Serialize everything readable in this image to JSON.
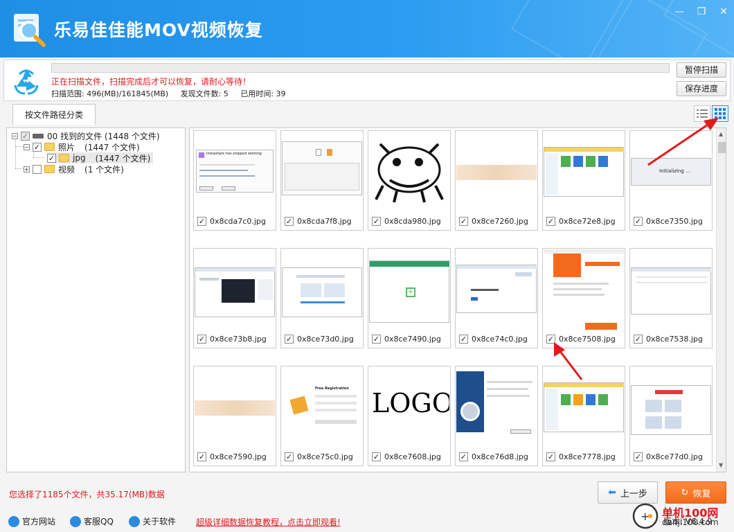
{
  "window": {
    "title": "乐易佳佳能MOV视频恢复",
    "minimize": "—",
    "maximize": "❐",
    "close": "✕"
  },
  "scan": {
    "progress": 0.0,
    "message": "正在扫描文件，扫描完成后才可以恢复，请耐心等待！",
    "range_label": "扫描范围: 496(MB)/161845(MB)",
    "found_label": "发现文件数: 5",
    "time_label": "已用时间: 39",
    "pause_label": "暂停扫描",
    "save_label": "保存进度"
  },
  "tabs": [
    {
      "label": "按文件路径分类"
    }
  ],
  "tree": {
    "root": {
      "label": "00 找到的文件 (1448 个文件)"
    },
    "photos": {
      "label": "照片",
      "count": "(1447 个文件)"
    },
    "jpg": {
      "label": "jpg",
      "count": "(1447 个文件)"
    },
    "videos": {
      "label": "视频",
      "count": "(1 个文件)"
    }
  },
  "files": [
    {
      "name": "0x8cda7c0.jpg"
    },
    {
      "name": "0x8cda7f8.jpg"
    },
    {
      "name": "0x8cda980.jpg"
    },
    {
      "name": "0x8ce7260.jpg"
    },
    {
      "name": "0x8ce72e8.jpg"
    },
    {
      "name": "0x8ce7350.jpg"
    },
    {
      "name": "0x8ce73b8.jpg"
    },
    {
      "name": "0x8ce73d0.jpg"
    },
    {
      "name": "0x8ce7490.jpg"
    },
    {
      "name": "0x8ce74c0.jpg"
    },
    {
      "name": "0x8ce7508.jpg"
    },
    {
      "name": "0x8ce7538.jpg"
    },
    {
      "name": "0x8ce7590.jpg"
    },
    {
      "name": "0x8ce75c0.jpg"
    },
    {
      "name": "0x8ce7608.jpg"
    },
    {
      "name": "0x8ce76d8.jpg"
    },
    {
      "name": "0x8ce7778.jpg"
    },
    {
      "name": "0x8ce77d0.jpg"
    }
  ],
  "thumbs": {
    "stopped_title": "Instashare has stopped working",
    "initializing": "Initializing ...",
    "logo_text": "LOGO",
    "free_reg": "Free Registration"
  },
  "bottom": {
    "selection_info": "您选择了1185个文件，共35.17(MB)数据",
    "prev_label": "上一步",
    "recover_label": "恢复"
  },
  "footer": {
    "website": "官方网站",
    "qq": "客服QQ",
    "about": "关于软件",
    "promo": "超级详细数据恢复教程，点击立即观看!",
    "version": "版本: V6.4.9"
  },
  "watermark": {
    "line1": "单机100网",
    "line2": "danji100.com"
  },
  "colors": {
    "accent_blue": "#2b9cf0",
    "warning_red": "#e0191f",
    "recover_orange": "#f36a1a",
    "annotation_red": "#e01a1a"
  }
}
